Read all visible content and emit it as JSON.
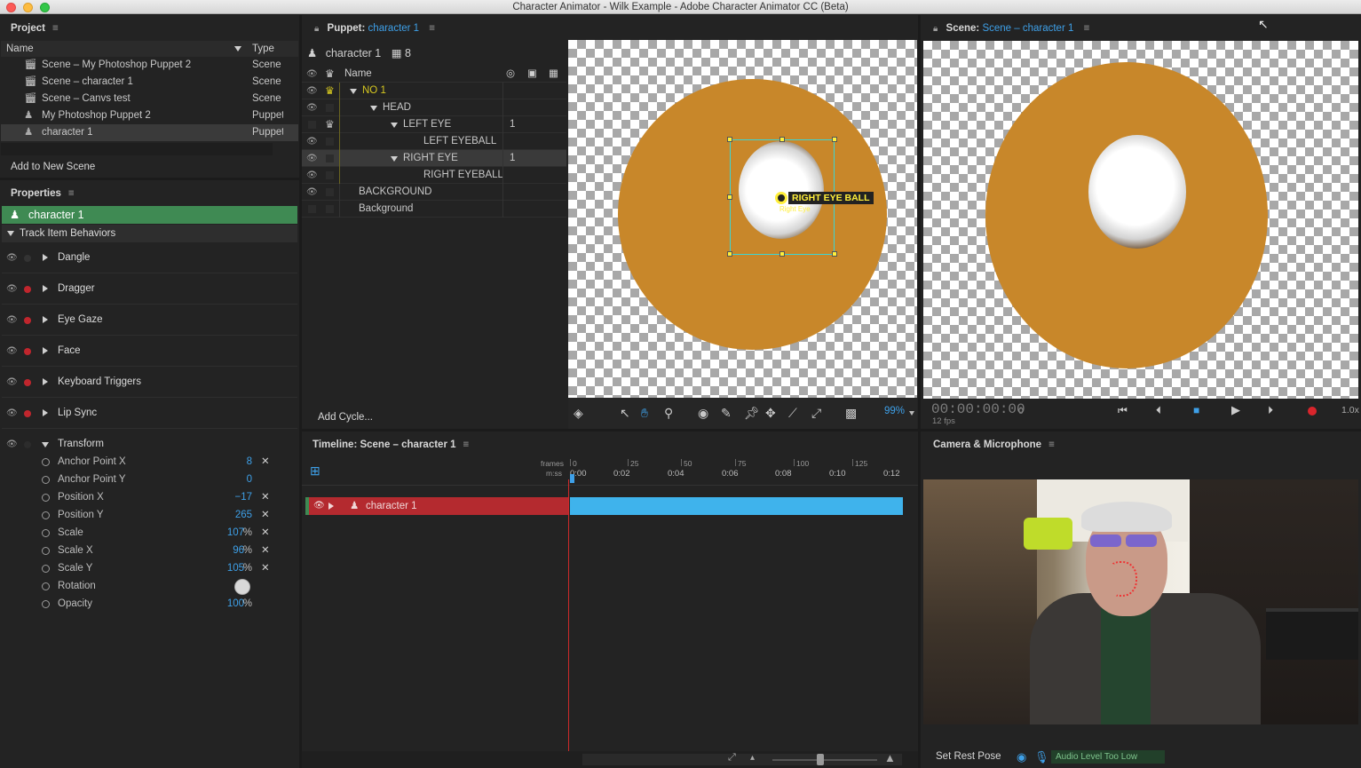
{
  "window": {
    "title": "Character Animator - Wilk Example - Adobe Character Animator CC (Beta)"
  },
  "project": {
    "title": "Project",
    "col_name": "Name",
    "col_type": "Type",
    "items": [
      {
        "name": "Scene – My Photoshop Puppet 2",
        "type": "Scene",
        "icon": "clapboard-icon"
      },
      {
        "name": "Scene – character 1",
        "type": "Scene",
        "icon": "clapboard-icon"
      },
      {
        "name": "Scene – Canvs test",
        "type": "Scene",
        "icon": "clapboard-icon"
      },
      {
        "name": "My Photoshop Puppet 2",
        "type": "Puppet",
        "icon": "puppet-icon"
      },
      {
        "name": "character 1",
        "type": "Puppet",
        "icon": "puppet-icon"
      }
    ],
    "add_button": "Add to New Scene"
  },
  "properties": {
    "title": "Properties",
    "selected": "character 1",
    "section": "Track Item Behaviors",
    "behaviors": [
      "Dangle",
      "Dragger",
      "Eye Gaze",
      "Face",
      "Keyboard Triggers",
      "Lip Sync",
      "Transform"
    ],
    "params": [
      {
        "label": "Anchor Point X",
        "value": "8",
        "unit": "",
        "reset": true
      },
      {
        "label": "Anchor Point Y",
        "value": "0",
        "unit": "",
        "reset": false
      },
      {
        "label": "Position X",
        "value": "−17",
        "unit": "",
        "reset": true
      },
      {
        "label": "Position Y",
        "value": "265",
        "unit": "",
        "reset": true
      },
      {
        "label": "Scale",
        "value": "107",
        "unit": "%",
        "reset": true
      },
      {
        "label": "Scale X",
        "value": "96",
        "unit": "%",
        "reset": true
      },
      {
        "label": "Scale Y",
        "value": "105",
        "unit": "%",
        "reset": true
      },
      {
        "label": "Rotation",
        "value": "",
        "unit": "",
        "reset": false
      },
      {
        "label": "Opacity",
        "value": "100",
        "unit": "%",
        "reset": false
      }
    ]
  },
  "puppet": {
    "title_prefix": "Puppet:",
    "title_name": "character 1",
    "header_name": "character 1",
    "header_count": "8",
    "col_name": "Name",
    "layers": [
      {
        "name": "NO 1",
        "num": ""
      },
      {
        "name": "HEAD",
        "num": ""
      },
      {
        "name": "LEFT EYE",
        "num": "1"
      },
      {
        "name": "LEFT EYEBALL",
        "num": ""
      },
      {
        "name": "RIGHT EYE",
        "num": "1"
      },
      {
        "name": "RIGHT EYEBALL",
        "num": ""
      },
      {
        "name": "BACKGROUND",
        "num": ""
      },
      {
        "name": "Background",
        "num": ""
      }
    ],
    "add_cycle": "Add Cycle...",
    "tag_label": "RIGHT EYE BALL",
    "tag_sub": "Right Eye",
    "zoom": "99%"
  },
  "scene": {
    "title_prefix": "Scene:",
    "title_name": "Scene – character 1",
    "timecode": "00:00:00:00",
    "frame": "0",
    "fps": "12 fps",
    "speed": "1.0x"
  },
  "timeline": {
    "title": "Timeline: Scene – character 1",
    "frames_label": "frames",
    "mss_label": "m:ss",
    "frame_ticks": [
      "0",
      "25",
      "50",
      "75",
      "100",
      "125"
    ],
    "time_ticks": [
      "0:00",
      "0:02",
      "0:04",
      "0:06",
      "0:08",
      "0:10",
      "0:12"
    ],
    "track": "character 1"
  },
  "camera": {
    "title": "Camera & Microphone",
    "set_rest_pose": "Set Rest Pose",
    "audio_status": "Audio Level Too Low"
  },
  "colors": {
    "accent": "#3ea0e8",
    "selection_green": "#3f8a53",
    "track_red": "#b42a2f",
    "clip_blue": "#3fb3ec",
    "head_orange": "#c8872a"
  }
}
